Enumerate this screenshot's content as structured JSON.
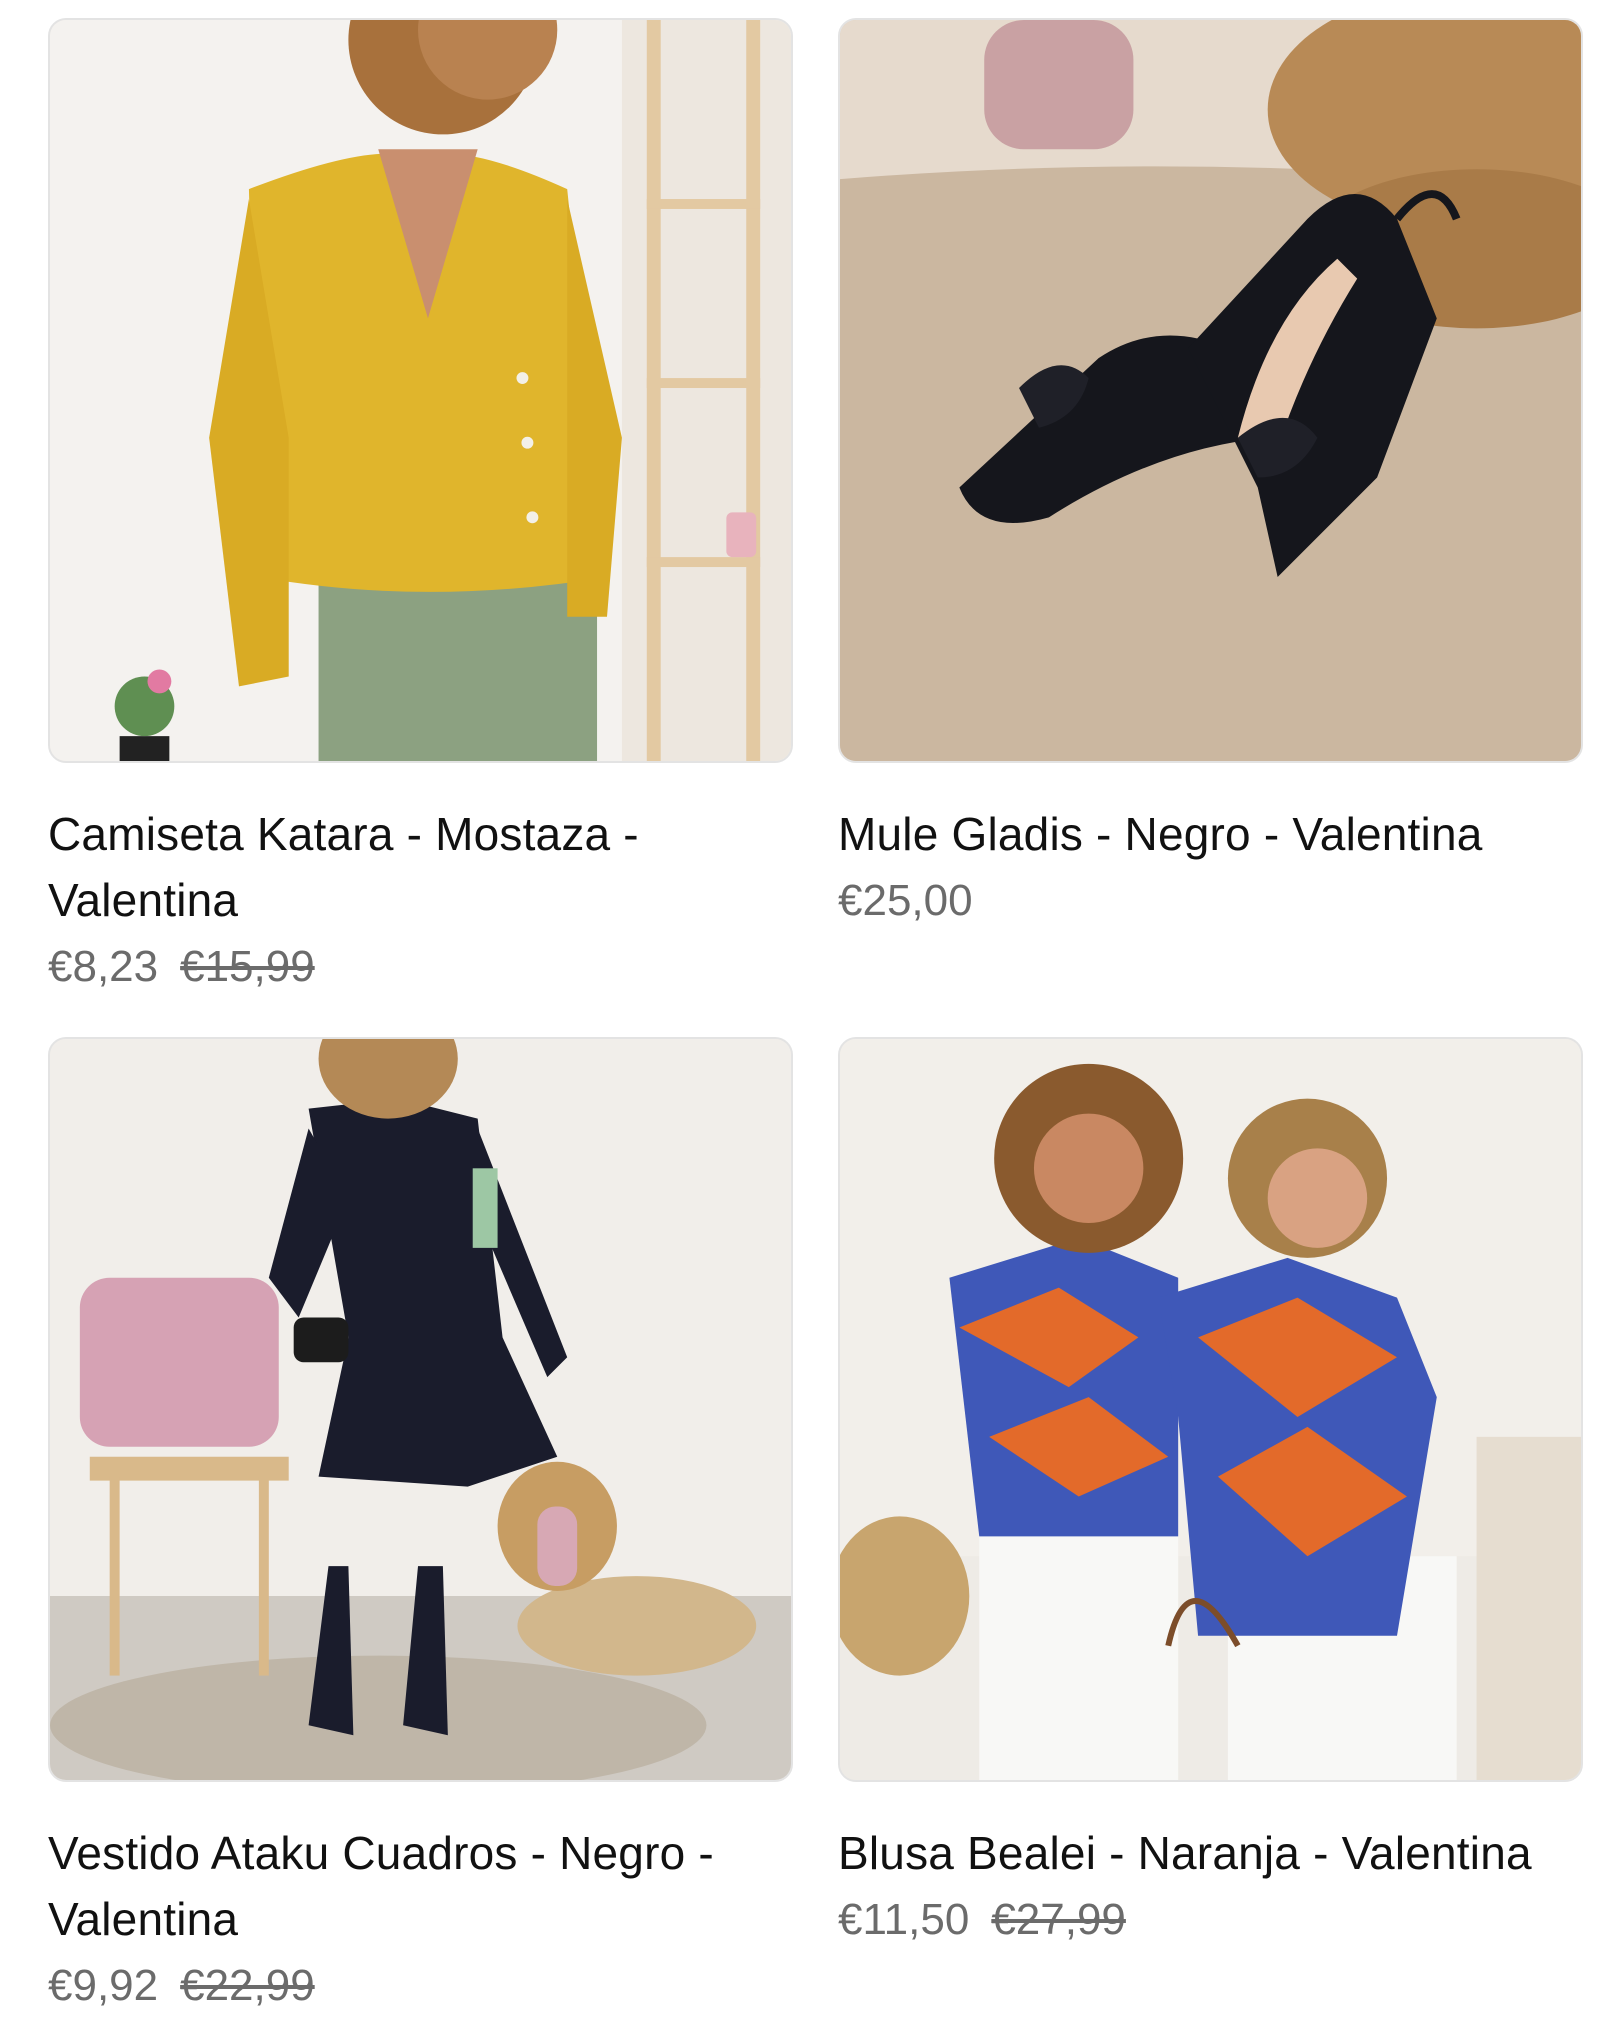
{
  "products": [
    {
      "title": "Camiseta Katara - Mostaza - Valentina",
      "price": "€8,23",
      "compare_price": "€15,99",
      "image_alt": "woman-in-mustard-cardigan"
    },
    {
      "title": "Mule Gladis - Negro - Valentina",
      "price": "€25,00",
      "compare_price": "",
      "image_alt": "black-bow-slingback-mules"
    },
    {
      "title": "Vestido Ataku Cuadros - Negro - Valentina",
      "price": "€9,92",
      "compare_price": "€22,99",
      "image_alt": "woman-in-black-dress-with-boots"
    },
    {
      "title": "Blusa Bealei - Naranja - Valentina",
      "price": "€11,50",
      "compare_price": "€27,99",
      "image_alt": "two-women-in-orange-blue-blouses"
    }
  ],
  "colors": {
    "title": "#111111",
    "price": "#6b6b6b",
    "card_border": "#e3e3e3"
  }
}
